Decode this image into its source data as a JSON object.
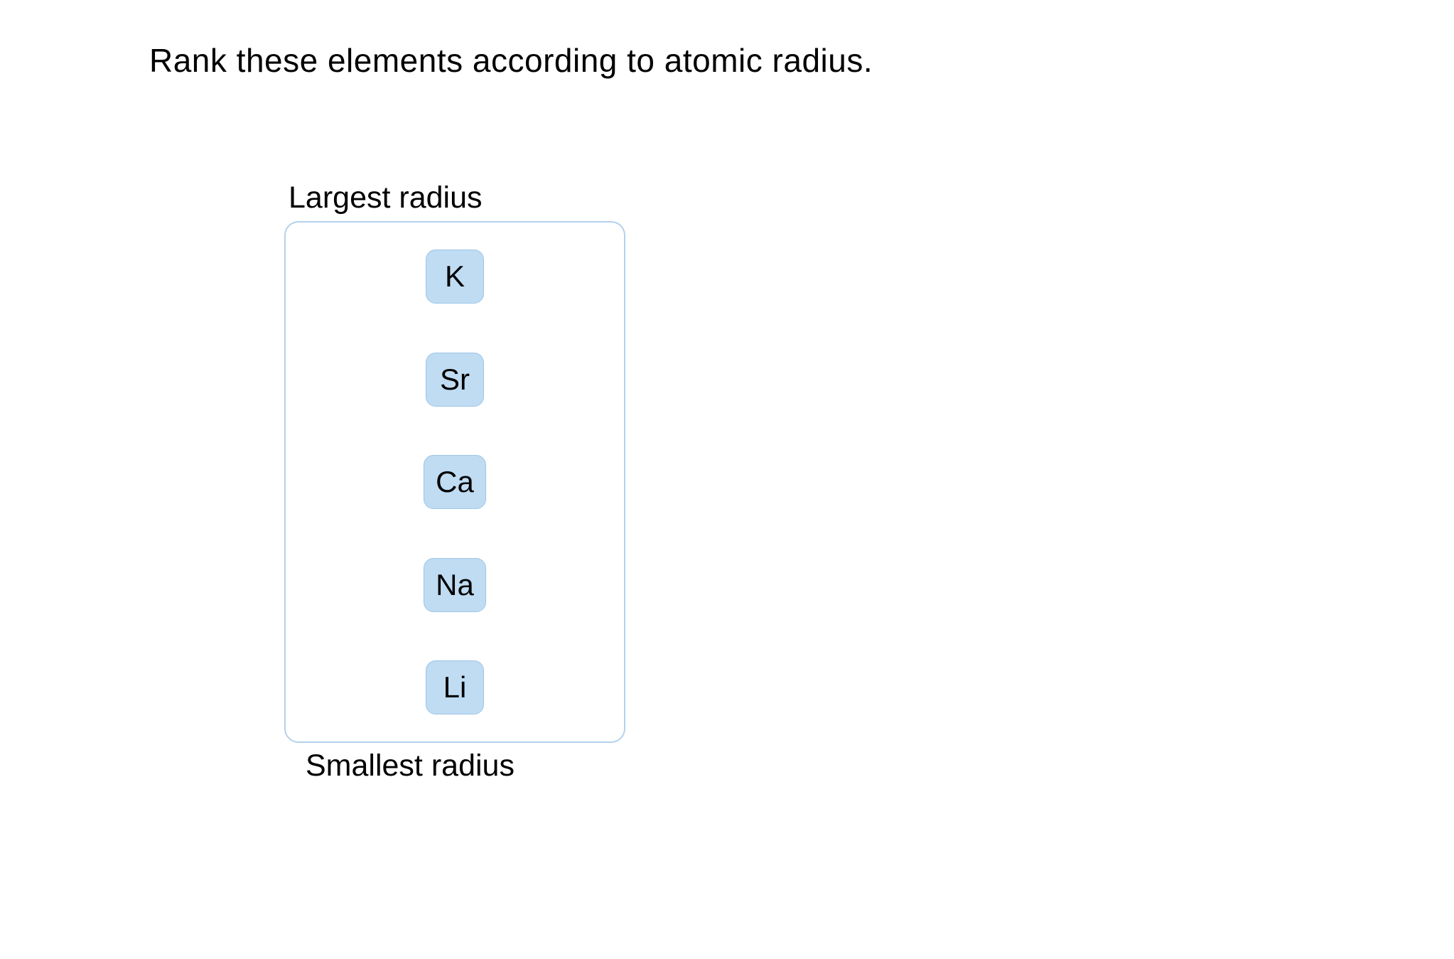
{
  "question": "Rank these elements according to atomic radius.",
  "ranking": {
    "top_label": "Largest radius",
    "bottom_label": "Smallest radius",
    "items": [
      "K",
      "Sr",
      "Ca",
      "Na",
      "Li"
    ]
  }
}
